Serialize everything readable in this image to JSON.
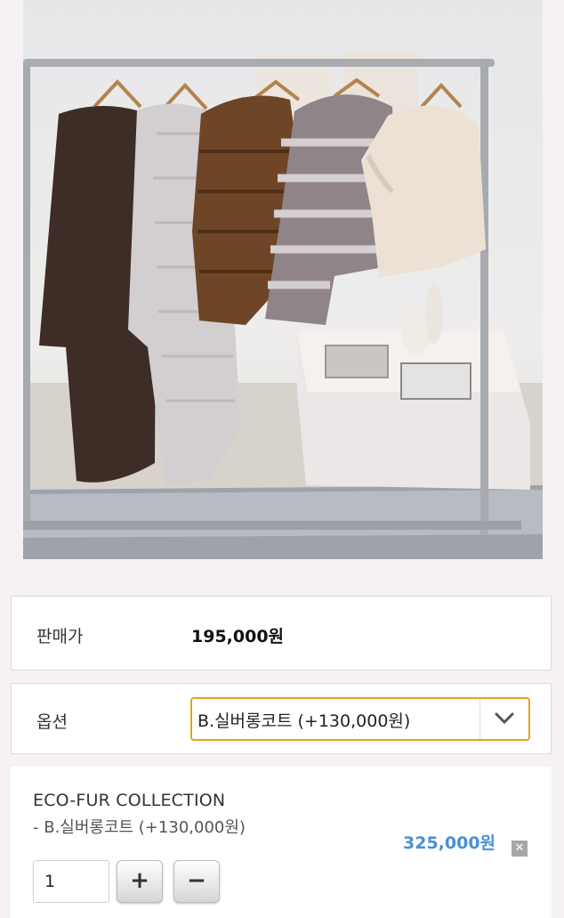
{
  "product": {
    "image_alt": "Eco-fur coats hanging on a clothing rack"
  },
  "price": {
    "label": "판매가",
    "value": "195,000원"
  },
  "option": {
    "label": "옵션",
    "selected": "B.실버롱코트 (+130,000원)",
    "icon": "chevron-down-icon"
  },
  "cart": {
    "title": "ECO-FUR COLLECTION",
    "option_line": "- B.실버롱코트 (+130,000원)",
    "total": "325,000원",
    "quantity": "1",
    "plus_label": "+",
    "minus_label": "−",
    "remove_label": "✕"
  },
  "colors": {
    "accent_border": "#e0a51f",
    "price_blue": "#4a8fd4"
  }
}
